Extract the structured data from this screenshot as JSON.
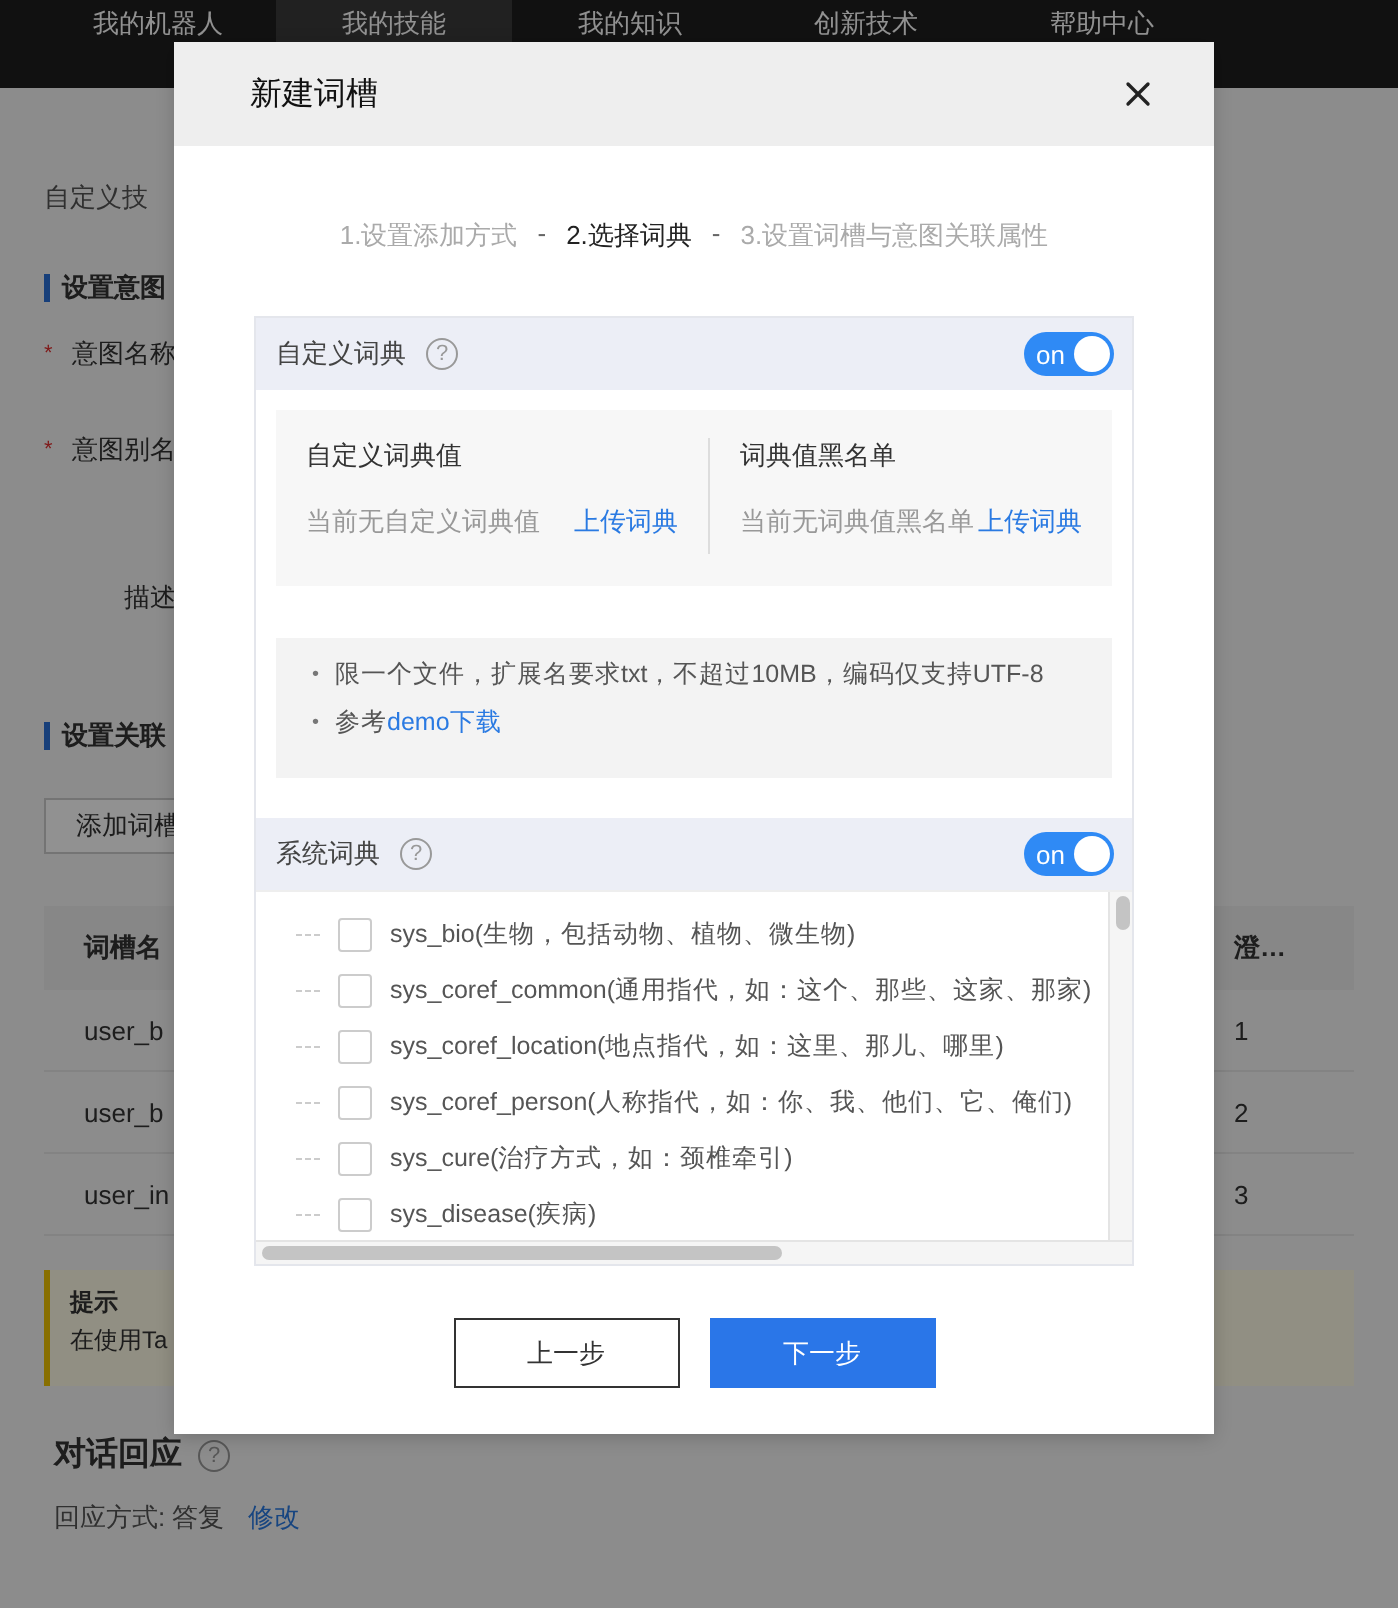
{
  "nav": {
    "items": [
      {
        "label": "我的机器人",
        "selected": false
      },
      {
        "label": "我的技能",
        "selected": true
      },
      {
        "label": "我的知识",
        "selected": false
      },
      {
        "label": "创新技术",
        "selected": false
      },
      {
        "label": "帮助中心",
        "selected": false
      }
    ]
  },
  "page": {
    "breadcrumb": "自定义技",
    "intent_section": "设置意图",
    "fields": [
      {
        "label": "意图名称",
        "required": true,
        "mark": "*"
      },
      {
        "label": "意图别名",
        "required": true,
        "mark": "*"
      },
      {
        "label": "描述",
        "required": false
      }
    ],
    "slot_section": "设置关联",
    "add_slot_button": "添加词槽",
    "table": {
      "columns": [
        "词槽名",
        "澄…"
      ],
      "rows": [
        [
          "user_b",
          "1"
        ],
        [
          "user_b",
          "2"
        ],
        [
          "user_in",
          "3"
        ]
      ]
    },
    "tip": {
      "title": "提示",
      "text": "在使用Ta"
    },
    "response": {
      "title": "对话回应",
      "help": "?",
      "mode": "回应方式: 答复",
      "edit_link": "修改"
    }
  },
  "dialog": {
    "title": "新建词槽",
    "steps": [
      {
        "label": "1.设置添加方式",
        "selected": false
      },
      {
        "label": "2.选择词典",
        "selected": true
      },
      {
        "label": "3.设置词槽与意图关联属性",
        "selected": false
      }
    ],
    "separators": [
      "-",
      "-"
    ],
    "custom": {
      "title": "自定义词典",
      "help": "?",
      "toggle": {
        "label": "on",
        "on": true
      },
      "columns": [
        {
          "title": "自定义词典值",
          "empty": "当前无自定义词典值",
          "link": "上传词典"
        },
        {
          "title": "词典值黑名单",
          "empty": "当前无词典值黑名单",
          "link": "上传词典"
        }
      ],
      "notes": [
        {
          "bullet": "•",
          "text": "限一个文件，扩展名要求txt，不超过10MB，编码仅支持UTF-8"
        },
        {
          "bullet": "•",
          "text": "参考",
          "link": "demo下载"
        }
      ]
    },
    "system": {
      "title": "系统词典",
      "help": "?",
      "toggle": {
        "label": "on",
        "on": true
      },
      "items": [
        {
          "label": "sys_bio(生物，包括动物、植物、微生物)",
          "checked": false
        },
        {
          "label": "sys_coref_common(通用指代，如：这个、那些、这家、那家)",
          "checked": false
        },
        {
          "label": "sys_coref_location(地点指代，如：这里、那儿、哪里)",
          "checked": false
        },
        {
          "label": "sys_coref_person(人称指代，如：你、我、他们、它、俺们)",
          "checked": false
        },
        {
          "label": "sys_cure(治疗方式，如：颈椎牵引)",
          "checked": false
        },
        {
          "label": "sys_disease(疾病)",
          "checked": false
        }
      ]
    },
    "buttons": {
      "prev": "上一步",
      "next": "下一步"
    }
  }
}
